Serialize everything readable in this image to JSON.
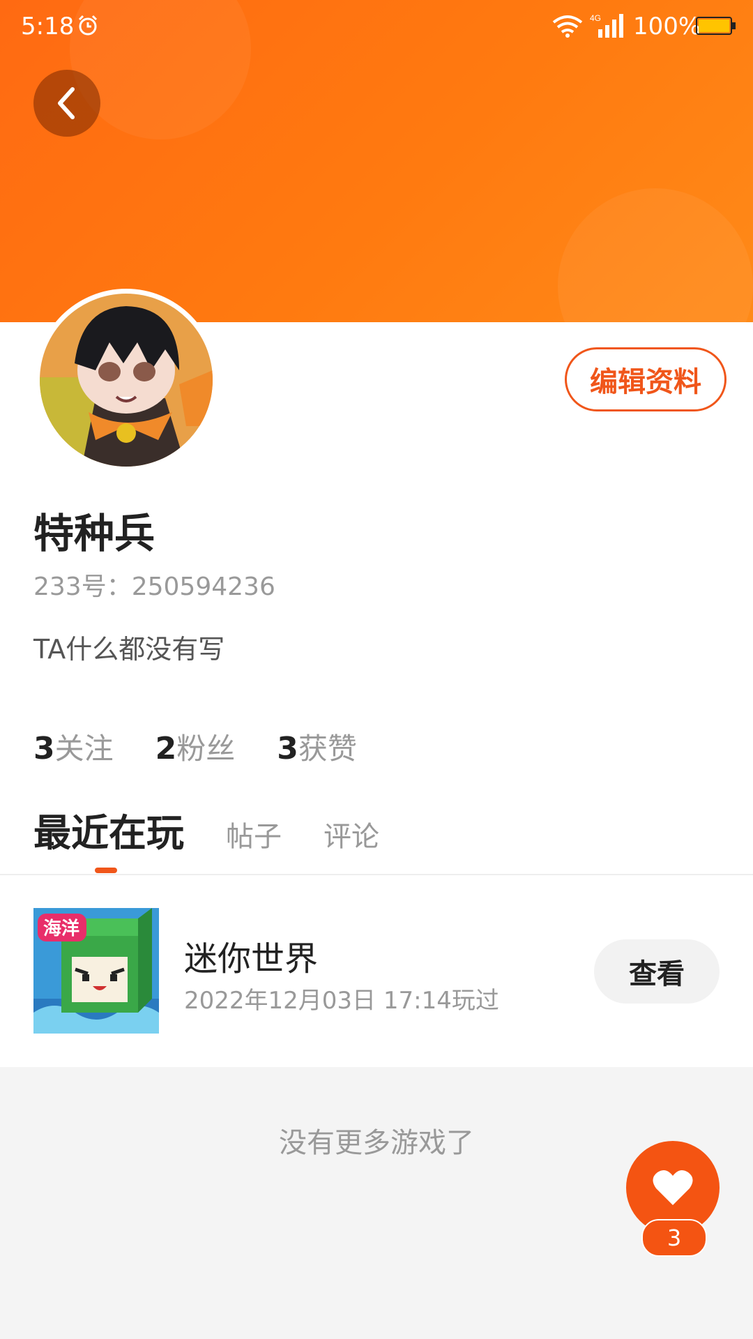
{
  "status_bar": {
    "time": "5:18",
    "battery": "100%",
    "network": "4G"
  },
  "colors": {
    "accent": "#f0561a",
    "banner": "#ff7a10",
    "like": "#f45412"
  },
  "profile": {
    "username": "特种兵",
    "id_line": "233号：250594236",
    "bio": "TA什么都没有写",
    "edit_label": "编辑资料"
  },
  "stats": [
    {
      "count": "3",
      "label": "关注"
    },
    {
      "count": "2",
      "label": "粉丝"
    },
    {
      "count": "3",
      "label": "获赞"
    }
  ],
  "tabs": [
    {
      "label": "最近在玩",
      "active": true
    },
    {
      "label": "帖子",
      "active": false
    },
    {
      "label": "评论",
      "active": false
    }
  ],
  "recent_game": {
    "name": "迷你世界",
    "played_at": "2022年12月03日 17:14玩过",
    "view_label": "查看",
    "icon": "mini-world-game-icon"
  },
  "empty_text": "没有更多游戏了",
  "like": {
    "count": "3",
    "icon": "heart-icon"
  }
}
